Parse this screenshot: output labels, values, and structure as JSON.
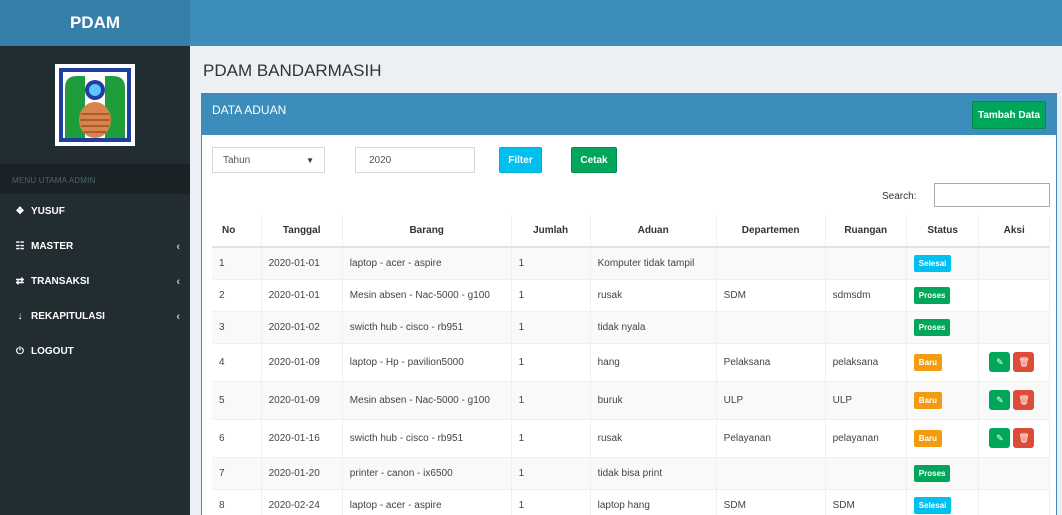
{
  "brand": "PDAM",
  "sidebar": {
    "header": "MENU UTAMA ADMIN",
    "items": [
      {
        "label": "YUSUF",
        "icon": "home-icon",
        "glyph": "❖",
        "chev": ""
      },
      {
        "label": "MASTER",
        "icon": "master-icon",
        "glyph": "☷",
        "chev": "‹"
      },
      {
        "label": "TRANSAKSI",
        "icon": "shuffle-icon",
        "glyph": "⇄",
        "chev": "‹"
      },
      {
        "label": "REKAPITULASI",
        "icon": "sort-icon",
        "glyph": "↓",
        "chev": "‹"
      },
      {
        "label": "LOGOUT",
        "icon": "power-icon",
        "glyph": "⏻",
        "chev": ""
      }
    ]
  },
  "page_title": "PDAM BANDARMASIH",
  "box": {
    "title": "DATA ADUAN",
    "add_button": "Tambah Data"
  },
  "filter": {
    "select_value": "Tahun",
    "year_value": "2020",
    "filter_button": "Filter",
    "print_button": "Cetak"
  },
  "search": {
    "label": "Search:"
  },
  "table": {
    "headers": [
      "No",
      "Tanggal",
      "Barang",
      "Jumlah",
      "Aduan",
      "Departemen",
      "Ruangan",
      "Status",
      "Aksi"
    ],
    "rows": [
      {
        "no": "1",
        "tanggal": "2020-01-01",
        "barang": "laptop - acer - aspire",
        "jumlah": "1",
        "aduan": "Komputer tidak tampil",
        "departemen": "",
        "ruangan": "",
        "status": "Selesai",
        "status_type": "selesai",
        "actions": false
      },
      {
        "no": "2",
        "tanggal": "2020-01-01",
        "barang": "Mesin absen - Nac-5000 - g100",
        "jumlah": "1",
        "aduan": "rusak",
        "departemen": "SDM",
        "ruangan": "sdmsdm",
        "status": "Proses",
        "status_type": "proses",
        "actions": false
      },
      {
        "no": "3",
        "tanggal": "2020-01-02",
        "barang": "swicth hub - cisco - rb951",
        "jumlah": "1",
        "aduan": "tidak nyala",
        "departemen": "",
        "ruangan": "",
        "status": "Proses",
        "status_type": "proses",
        "actions": false
      },
      {
        "no": "4",
        "tanggal": "2020-01-09",
        "barang": "laptop - Hp - pavilion5000",
        "jumlah": "1",
        "aduan": "hang",
        "departemen": "Pelaksana",
        "ruangan": "pelaksana",
        "status": "Baru",
        "status_type": "baru",
        "actions": true
      },
      {
        "no": "5",
        "tanggal": "2020-01-09",
        "barang": "Mesin absen - Nac-5000 - g100",
        "jumlah": "1",
        "aduan": "buruk",
        "departemen": "ULP",
        "ruangan": "ULP",
        "status": "Baru",
        "status_type": "baru",
        "actions": true
      },
      {
        "no": "6",
        "tanggal": "2020-01-16",
        "barang": "swicth hub - cisco - rb951",
        "jumlah": "1",
        "aduan": "rusak",
        "departemen": "Pelayanan",
        "ruangan": "pelayanan",
        "status": "Baru",
        "status_type": "baru",
        "actions": true
      },
      {
        "no": "7",
        "tanggal": "2020-01-20",
        "barang": "printer - canon - ix6500",
        "jumlah": "1",
        "aduan": "tidak bisa print",
        "departemen": "",
        "ruangan": "",
        "status": "Proses",
        "status_type": "proses",
        "actions": false
      },
      {
        "no": "8",
        "tanggal": "2020-02-24",
        "barang": "laptop - acer - aspire",
        "jumlah": "1",
        "aduan": "laptop hang",
        "departemen": "SDM",
        "ruangan": "SDM",
        "status": "Selesai",
        "status_type": "selesai",
        "actions": false
      }
    ]
  },
  "colors": {
    "navbar": "#3c8dbc",
    "logo_bg": "#367fa9",
    "sidebar": "#222d32",
    "success": "#00a65a",
    "info": "#00c0ef",
    "warning": "#f39c12",
    "danger": "#dd4b39"
  }
}
